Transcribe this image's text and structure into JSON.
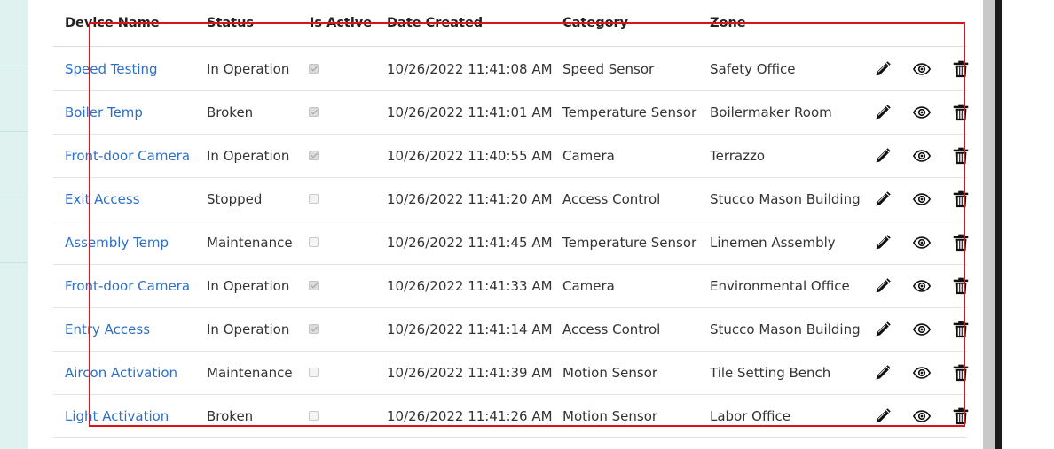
{
  "table": {
    "headers": {
      "device_name": "Device Name",
      "status": "Status",
      "is_active": "Is Active",
      "date_created": "Date Created",
      "category": "Category",
      "zone": "Zone"
    },
    "rows": [
      {
        "device_name": "Speed Testing",
        "status": "In Operation",
        "is_active": true,
        "date_created": "10/26/2022 11:41:08 AM",
        "category": "Speed Sensor",
        "zone": "Safety Office"
      },
      {
        "device_name": "Boiler Temp",
        "status": "Broken",
        "is_active": true,
        "date_created": "10/26/2022 11:41:01 AM",
        "category": "Temperature Sensor",
        "zone": "Boilermaker Room"
      },
      {
        "device_name": "Front-door Camera",
        "status": "In Operation",
        "is_active": true,
        "date_created": "10/26/2022 11:40:55 AM",
        "category": "Camera",
        "zone": "Terrazzo"
      },
      {
        "device_name": "Exit Access",
        "status": "Stopped",
        "is_active": false,
        "date_created": "10/26/2022 11:41:20 AM",
        "category": "Access Control",
        "zone": "Stucco Mason Building"
      },
      {
        "device_name": "Assembly Temp",
        "status": "Maintenance",
        "is_active": false,
        "date_created": "10/26/2022 11:41:45 AM",
        "category": "Temperature Sensor",
        "zone": "Linemen Assembly"
      },
      {
        "device_name": "Front-door Camera",
        "status": "In Operation",
        "is_active": true,
        "date_created": "10/26/2022 11:41:33 AM",
        "category": "Camera",
        "zone": "Environmental Office"
      },
      {
        "device_name": "Entry Access",
        "status": "In Operation",
        "is_active": true,
        "date_created": "10/26/2022 11:41:14 AM",
        "category": "Access Control",
        "zone": "Stucco Mason Building"
      },
      {
        "device_name": "Aircon Activation",
        "status": "Maintenance",
        "is_active": false,
        "date_created": "10/26/2022 11:41:39 AM",
        "category": "Motion Sensor",
        "zone": "Tile Setting Bench"
      },
      {
        "device_name": "Light Activation",
        "status": "Broken",
        "is_active": false,
        "date_created": "10/26/2022 11:41:26 AM",
        "category": "Motion Sensor",
        "zone": "Labor Office"
      }
    ],
    "row_actions": [
      "pencil-icon",
      "eye-icon",
      "trash-icon"
    ]
  },
  "colors": {
    "link": "#2d6fc7",
    "selection_border": "#d9141a",
    "sidebar": "#dff2ef"
  }
}
